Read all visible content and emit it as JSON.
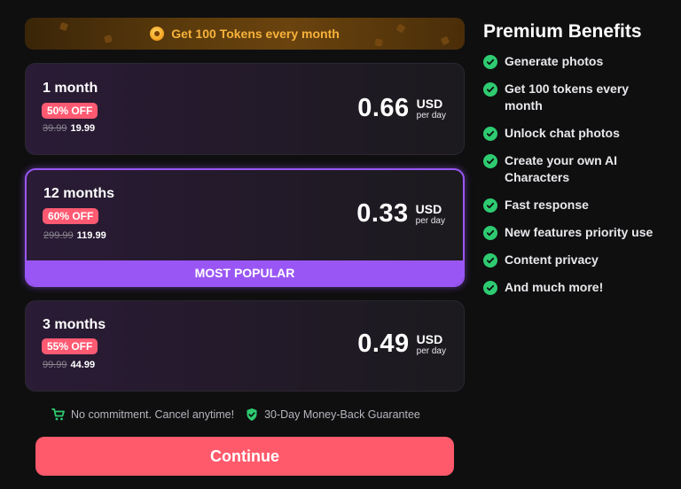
{
  "banner": {
    "text": "Get 100 Tokens every month",
    "icon": "coin-icon"
  },
  "plans": [
    {
      "name": "1 month",
      "discount": "50% OFF",
      "old_price": "39.99",
      "new_price": "19.99",
      "per_price": "0.66",
      "currency": "USD",
      "per_unit": "per day",
      "selected": false
    },
    {
      "name": "12 months",
      "discount": "60% OFF",
      "old_price": "299.99",
      "new_price": "119.99",
      "per_price": "0.33",
      "currency": "USD",
      "per_unit": "per day",
      "selected": true,
      "badge": "MOST POPULAR"
    },
    {
      "name": "3 months",
      "discount": "55% OFF",
      "old_price": "99.99",
      "new_price": "44.99",
      "per_price": "0.49",
      "currency": "USD",
      "per_unit": "per day",
      "selected": false
    }
  ],
  "guarantee": {
    "commitment": "No commitment. Cancel anytime!",
    "money_back": "30-Day Money-Back Guarantee"
  },
  "continue_label": "Continue",
  "benefits": {
    "title": "Premium Benefits",
    "items": [
      "Generate photos",
      "Get 100 tokens every month",
      "Unlock chat photos",
      "Create your own AI Characters",
      "Fast response",
      "New features priority use",
      "Content privacy",
      "And much more!"
    ]
  },
  "colors": {
    "accent_purple": "#9a56f5",
    "discount_pink": "#ff5a72",
    "continue_red": "#ff5a6b",
    "check_green": "#2ecb71",
    "banner_gold": "#f7b23b"
  }
}
